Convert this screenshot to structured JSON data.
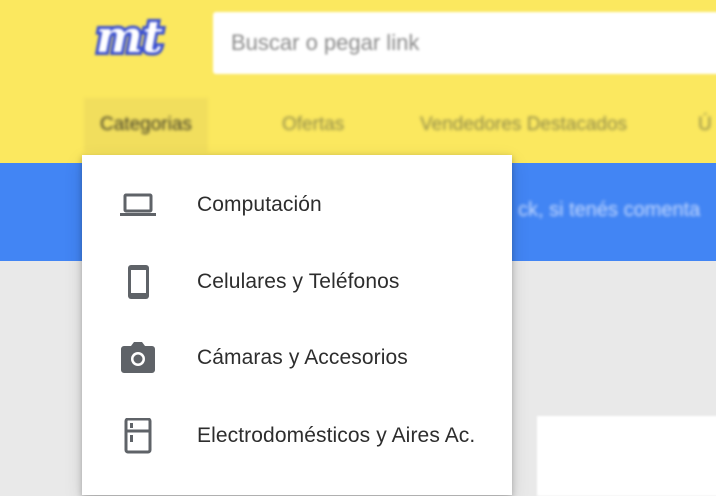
{
  "header": {
    "logo_text": "mt",
    "search": {
      "placeholder": "Buscar o pegar link",
      "value": ""
    },
    "nav_tabs": [
      {
        "label": "Categorias"
      },
      {
        "label": "Ofertas"
      },
      {
        "label": "Vendedores Destacados"
      },
      {
        "label": "Ú"
      }
    ]
  },
  "banner": {
    "text": "ck, si tenés comenta"
  },
  "dropdown": {
    "items": [
      {
        "label": "Computación",
        "icon": "laptop-icon"
      },
      {
        "label": "Celulares y Teléfonos",
        "icon": "phone-icon"
      },
      {
        "label": "Cámaras y Accesorios",
        "icon": "camera-icon"
      },
      {
        "label": "Electrodomésticos y Aires Ac.",
        "icon": "fridge-icon"
      }
    ]
  },
  "colors": {
    "header_bg": "#fbe85f",
    "banner_bg": "#4285f4",
    "icon": "#5f6368",
    "logo_blue": "#3a4fd0"
  }
}
